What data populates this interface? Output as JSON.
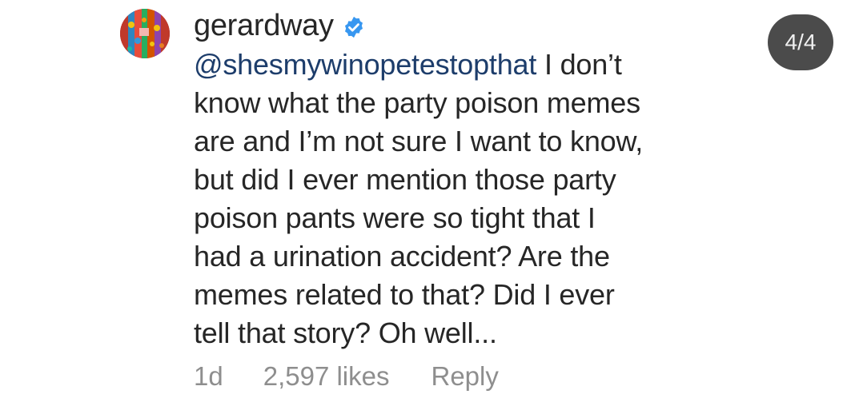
{
  "comment": {
    "username": "gerardway",
    "verified_icon": "verified-badge-icon",
    "mention": "@shesmywinopetestopthat",
    "line1_rest": " I don’t",
    "lines": [
      "know what the party poison memes",
      "are and I’m not sure I want to know,",
      "but did I ever mention those party",
      "poison pants were so tight that I",
      "had a urination accident? Are the",
      "memes related to that? Did I ever",
      "tell that story? Oh well..."
    ]
  },
  "meta": {
    "age": "1d",
    "likes": "2,597 likes",
    "reply_label": "Reply"
  },
  "pager": {
    "label": "4/4"
  },
  "colors": {
    "text": "#262626",
    "mention": "#1d3d6b",
    "meta": "#8e8e8e",
    "verified": "#3897f0",
    "pill": "#4b4b4b"
  }
}
